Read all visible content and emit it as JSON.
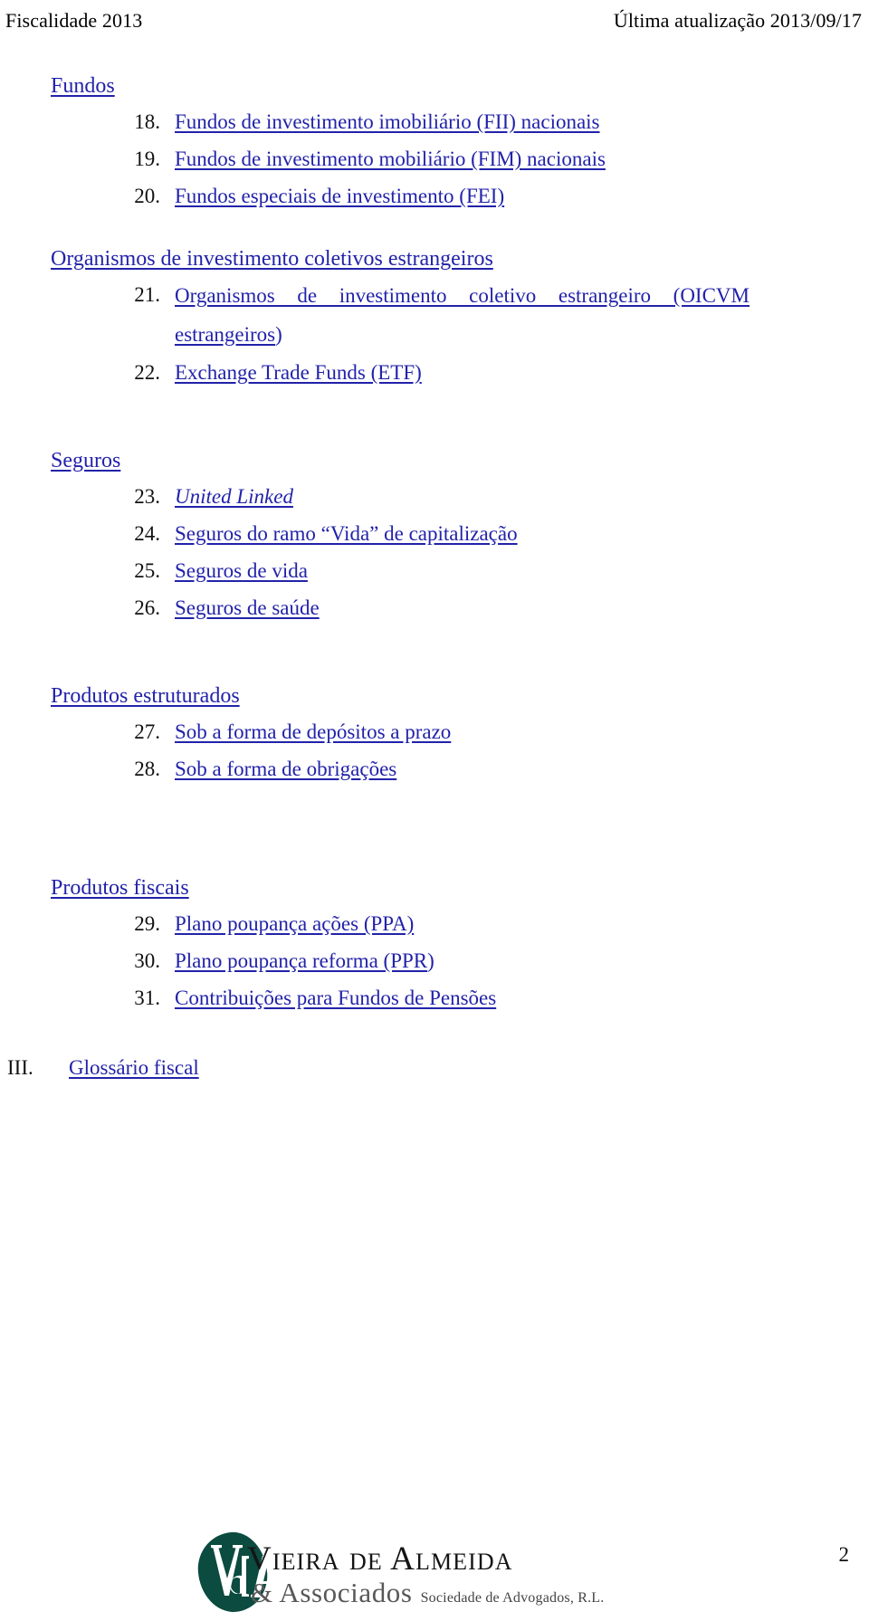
{
  "header": {
    "left": "Fiscalidade 2013",
    "right": "Última atualização 2013/09/17"
  },
  "colors": {
    "link": "#2222AA",
    "text": "#111111",
    "logo_green": "#0B4B40",
    "logo_gray": "#585858",
    "background": "#FFFFFF"
  },
  "toc": {
    "groups": [
      {
        "heading": "Fundos",
        "items": [
          {
            "number": "18.",
            "text": "Fundos de investimento imobiliário (FII) nacionais"
          },
          {
            "number": "19.",
            "text": "Fundos de investimento mobiliário (FIM) nacionais"
          },
          {
            "number": "20.",
            "text": "Fundos especiais de investimento (FEI)"
          }
        ]
      },
      {
        "heading": "Organismos de investimento coletivos estrangeiros",
        "items": [
          {
            "number": "21.",
            "text": "Organismos de investimento coletivo estrangeiro (OICVM estrangeiros",
            "tail": ")"
          },
          {
            "number": "22.",
            "text": "Exchange Trade Funds (ETF)"
          }
        ]
      },
      {
        "heading": "Seguros",
        "items": [
          {
            "number": "23.",
            "text": "United Linked",
            "style": "italic"
          },
          {
            "number": "24.",
            "text": "Seguros do ramo “Vida” de capitalização"
          },
          {
            "number": "25.",
            "text": "Seguros de vida"
          },
          {
            "number": "26.",
            "text": "Seguros de saúde"
          }
        ]
      },
      {
        "heading": "Produtos estruturados",
        "items": [
          {
            "number": "27.",
            "text": "Sob a forma de depósitos a prazo"
          },
          {
            "number": "28.",
            "text": "Sob a forma de obrigações"
          }
        ]
      },
      {
        "heading": "Produtos fiscais",
        "items": [
          {
            "number": "29.",
            "text": "Plano poupança ações (PPA)"
          },
          {
            "number": "30.",
            "text": "Plano poupança reforma (PPR",
            "tail": ")"
          },
          {
            "number": "31.",
            "text": "Contribuições para Fundos de Pensões"
          }
        ]
      }
    ],
    "roman_entry": {
      "number": "III.",
      "text": "Glossário fiscal"
    }
  },
  "footer": {
    "logo": {
      "mark": "vda-monogram-icon",
      "line1": "Vieira de Almeida",
      "associados": "& Associados",
      "subtitle": "Sociedade de Advogados, R.L."
    },
    "page_number": "2"
  }
}
